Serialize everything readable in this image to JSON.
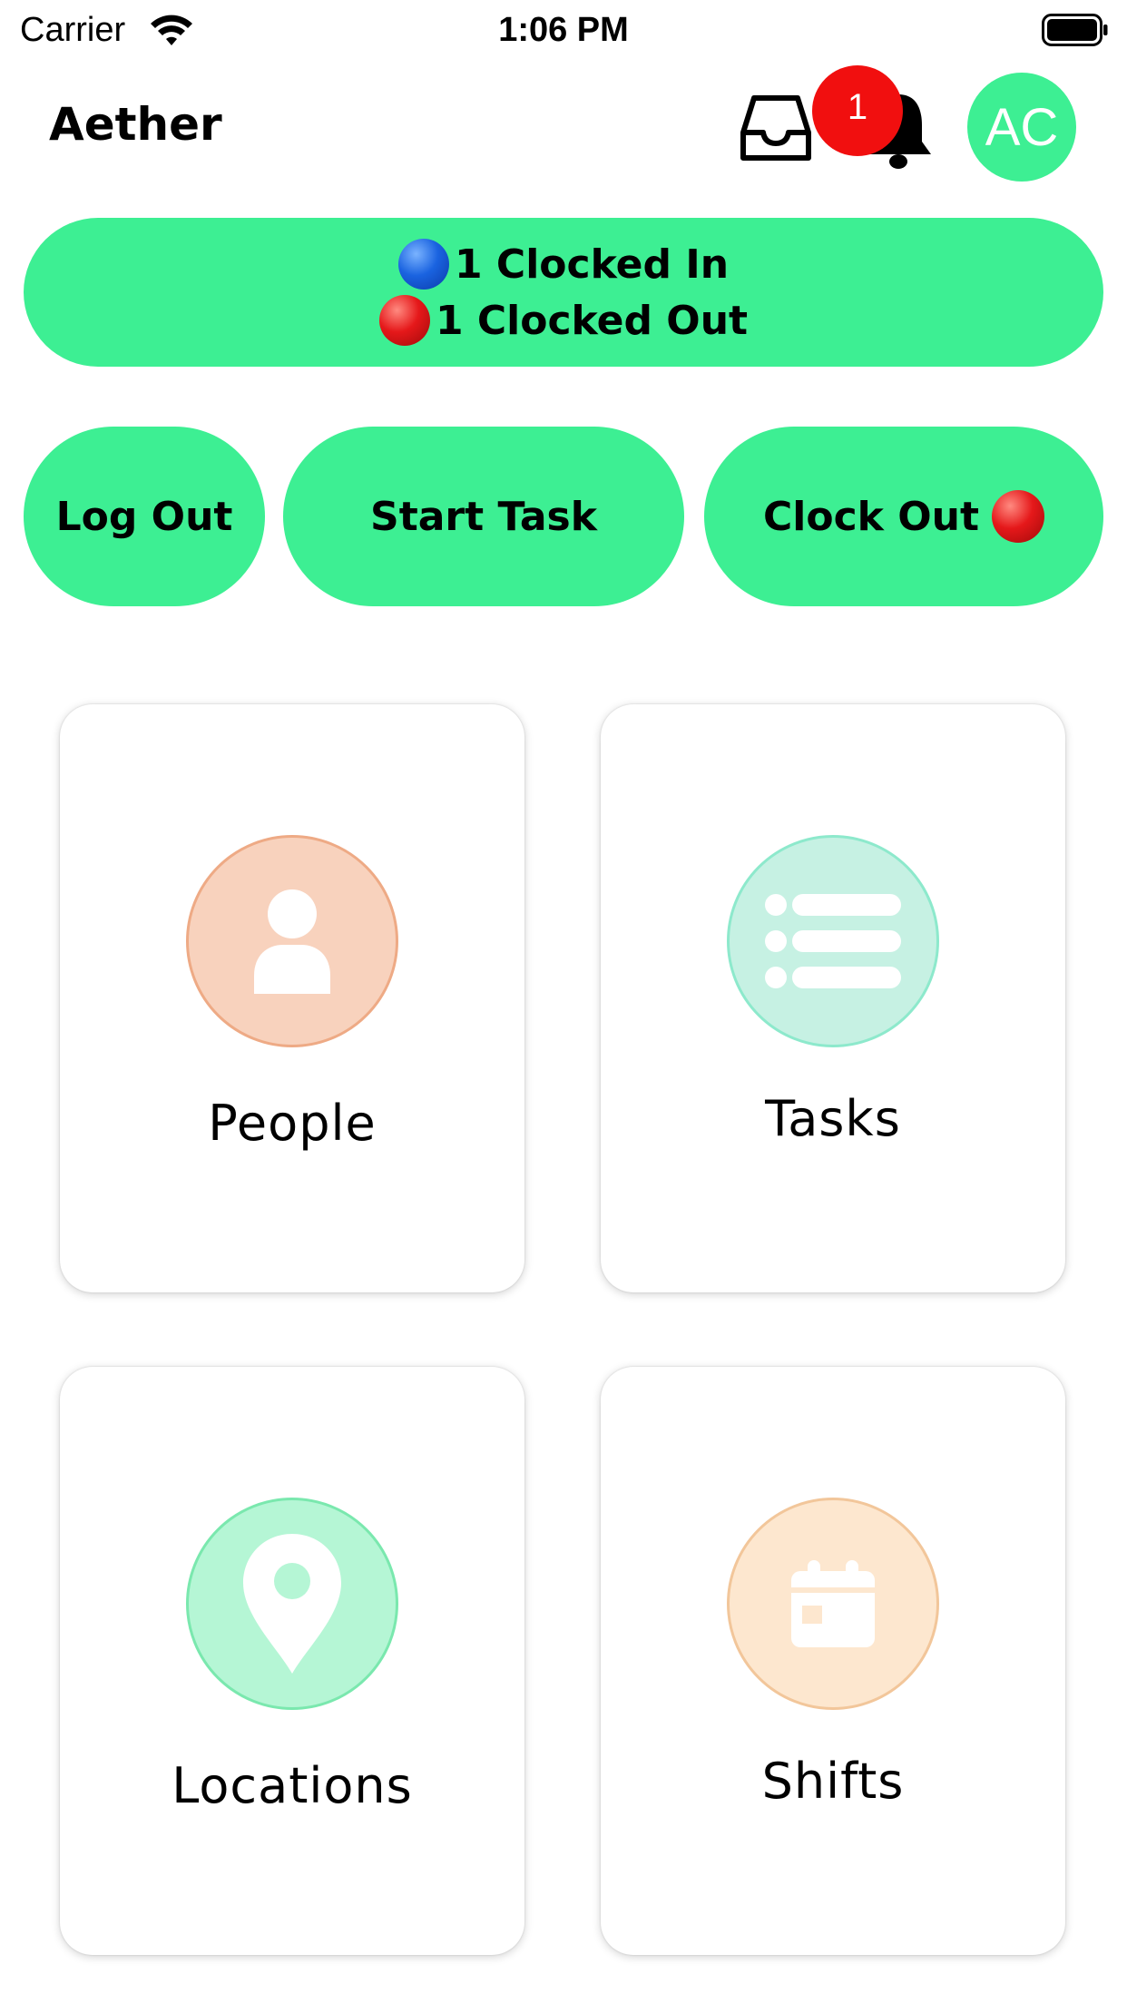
{
  "status_bar": {
    "carrier": "Carrier",
    "time": "1:06 PM"
  },
  "header": {
    "title": "Aether",
    "notification_count": "1",
    "avatar_initials": "AC",
    "icons": [
      "inbox-icon",
      "bell-icon"
    ]
  },
  "clock_status": {
    "clocked_in": "1 Clocked In",
    "clocked_out": "1 Clocked Out"
  },
  "actions": {
    "logout": "Log Out",
    "start_task": "Start Task",
    "clock_out": "Clock Out"
  },
  "tiles": [
    {
      "label": "People",
      "icon": "person-icon",
      "color": "#f8d2bd"
    },
    {
      "label": "Tasks",
      "icon": "list-icon",
      "color": "#c6f1e3"
    },
    {
      "label": "Locations",
      "icon": "map-pin-icon",
      "color": "#b5f6d5"
    },
    {
      "label": "Shifts",
      "icon": "calendar-icon",
      "color": "#fde7cf"
    }
  ],
  "colors": {
    "accent": "#3def93",
    "badge": "#f10f0f",
    "clocked_in_dot": "#1a63e0",
    "clocked_out_dot": "#e5181a"
  }
}
